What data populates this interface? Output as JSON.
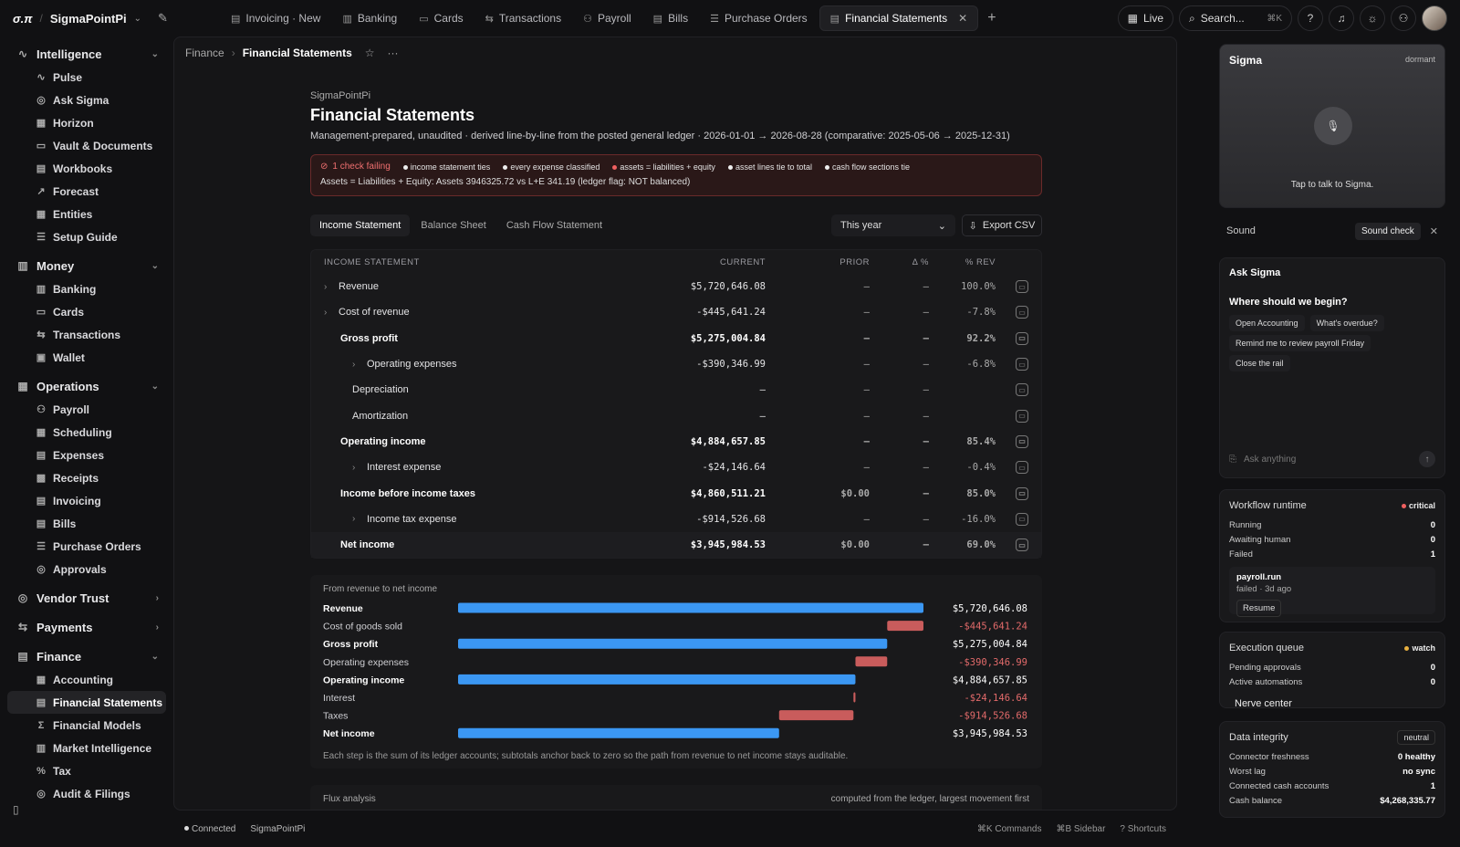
{
  "topbar": {
    "logo": "σ.π",
    "workspace": "SigmaPointPi",
    "tabs": [
      {
        "label": "Invoicing · New",
        "icon": "▤"
      },
      {
        "label": "Banking",
        "icon": "▥"
      },
      {
        "label": "Cards",
        "icon": "▭"
      },
      {
        "label": "Transactions",
        "icon": "⇆"
      },
      {
        "label": "Payroll",
        "icon": "⚇"
      },
      {
        "label": "Bills",
        "icon": "▤"
      },
      {
        "label": "Purchase Orders",
        "icon": "☰"
      },
      {
        "label": "Financial Statements",
        "icon": "▤",
        "active": true
      }
    ],
    "live_label": "Live",
    "search_placeholder": "Search...",
    "search_shortcut": "⌘K"
  },
  "sidebar": {
    "groups": [
      {
        "label": "Intelligence",
        "icon": "∿",
        "expanded": true,
        "items": [
          {
            "label": "Pulse",
            "icon": "∿"
          },
          {
            "label": "Ask Sigma",
            "icon": "◎"
          },
          {
            "label": "Horizon",
            "icon": "▦"
          },
          {
            "label": "Vault & Documents",
            "icon": "▭"
          },
          {
            "label": "Workbooks",
            "icon": "▤"
          },
          {
            "label": "Forecast",
            "icon": "↗"
          },
          {
            "label": "Entities",
            "icon": "▦"
          },
          {
            "label": "Setup Guide",
            "icon": "☰"
          }
        ]
      },
      {
        "label": "Money",
        "icon": "▥",
        "expanded": true,
        "items": [
          {
            "label": "Banking",
            "icon": "▥"
          },
          {
            "label": "Cards",
            "icon": "▭"
          },
          {
            "label": "Transactions",
            "icon": "⇆"
          },
          {
            "label": "Wallet",
            "icon": "▣"
          }
        ]
      },
      {
        "label": "Operations",
        "icon": "▦",
        "expanded": true,
        "items": [
          {
            "label": "Payroll",
            "icon": "⚇"
          },
          {
            "label": "Scheduling",
            "icon": "▦"
          },
          {
            "label": "Expenses",
            "icon": "▤"
          },
          {
            "label": "Receipts",
            "icon": "▩"
          },
          {
            "label": "Invoicing",
            "icon": "▤"
          },
          {
            "label": "Bills",
            "icon": "▤"
          },
          {
            "label": "Purchase Orders",
            "icon": "☰"
          },
          {
            "label": "Approvals",
            "icon": "◎"
          }
        ]
      },
      {
        "label": "Vendor Trust",
        "icon": "◎",
        "expanded": false,
        "items": []
      },
      {
        "label": "Payments",
        "icon": "⇆",
        "expanded": false,
        "items": []
      },
      {
        "label": "Finance",
        "icon": "▤",
        "expanded": true,
        "items": [
          {
            "label": "Accounting",
            "icon": "▦"
          },
          {
            "label": "Financial Statements",
            "icon": "▤",
            "active": true
          },
          {
            "label": "Financial Models",
            "icon": "Σ"
          },
          {
            "label": "Market Intelligence",
            "icon": "▥"
          },
          {
            "label": "Tax",
            "icon": "%"
          },
          {
            "label": "Audit & Filings",
            "icon": "◎"
          }
        ]
      }
    ]
  },
  "breadcrumb": {
    "parent": "Finance",
    "current": "Financial Statements"
  },
  "page": {
    "org": "SigmaPointPi",
    "title": "Financial Statements",
    "subtitle": "Management-prepared, unaudited · derived line-by-line from the posted general ledger · 2026-01-01 → 2026-08-28 (comparative: 2025-05-06 → 2025-12-31)"
  },
  "checks": {
    "failing": "1 check failing",
    "items": [
      {
        "label": "income statement ties",
        "ok": true
      },
      {
        "label": "every expense classified",
        "ok": true
      },
      {
        "label": "assets = liabilities + equity",
        "ok": false
      },
      {
        "label": "asset lines tie to total",
        "ok": true
      },
      {
        "label": "cash flow sections tie",
        "ok": true
      }
    ],
    "detail": "Assets = Liabilities + Equity: Assets 3946325.72 vs L+E 341.19 (ledger flag: NOT balanced)"
  },
  "statement_tabs": [
    "Income Statement",
    "Balance Sheet",
    "Cash Flow Statement"
  ],
  "period": "This year",
  "export_label": "Export CSV",
  "table": {
    "headers": [
      "INCOME STATEMENT",
      "CURRENT",
      "PRIOR",
      "Δ %",
      "% REV"
    ],
    "rows": [
      {
        "label": "Revenue",
        "current": "$5,720,646.08",
        "prior": "—",
        "delta": "—",
        "rev": "100.0%",
        "level": 0,
        "expandable": true,
        "bold": false
      },
      {
        "label": "Cost of revenue",
        "current": "-$445,641.24",
        "prior": "—",
        "delta": "—",
        "rev": "-7.8%",
        "level": 0,
        "expandable": true,
        "bold": false
      },
      {
        "label": "Gross profit",
        "current": "$5,275,004.84",
        "prior": "—",
        "delta": "—",
        "rev": "92.2%",
        "level": 1,
        "expandable": false,
        "bold": true
      },
      {
        "label": "Operating expenses",
        "current": "-$390,346.99",
        "prior": "—",
        "delta": "—",
        "rev": "-6.8%",
        "level": 2,
        "expandable": true,
        "bold": false
      },
      {
        "label": "Depreciation",
        "current": "—",
        "prior": "—",
        "delta": "—",
        "rev": "",
        "level": 3,
        "expandable": false,
        "bold": false
      },
      {
        "label": "Amortization",
        "current": "—",
        "prior": "—",
        "delta": "—",
        "rev": "",
        "level": 3,
        "expandable": false,
        "bold": false
      },
      {
        "label": "Operating income",
        "current": "$4,884,657.85",
        "prior": "—",
        "delta": "—",
        "rev": "85.4%",
        "level": 1,
        "expandable": false,
        "bold": true
      },
      {
        "label": "Interest expense",
        "current": "-$24,146.64",
        "prior": "—",
        "delta": "—",
        "rev": "-0.4%",
        "level": 2,
        "expandable": true,
        "bold": false
      },
      {
        "label": "Income before income taxes",
        "current": "$4,860,511.21",
        "prior": "$0.00",
        "delta": "—",
        "rev": "85.0%",
        "level": 1,
        "expandable": false,
        "bold": true
      },
      {
        "label": "Income tax expense",
        "current": "-$914,526.68",
        "prior": "—",
        "delta": "—",
        "rev": "-16.0%",
        "level": 2,
        "expandable": true,
        "bold": false
      },
      {
        "label": "Net income",
        "current": "$3,945,984.53",
        "prior": "$0.00",
        "delta": "—",
        "rev": "69.0%",
        "level": 1,
        "expandable": false,
        "bold": true
      }
    ]
  },
  "chart_data": {
    "type": "bar",
    "title": "From revenue to net income",
    "categories": [
      "Revenue",
      "Cost of goods sold",
      "Gross profit",
      "Operating expenses",
      "Operating income",
      "Interest",
      "Taxes",
      "Net income"
    ],
    "values": [
      5720646.08,
      -445641.24,
      5275004.84,
      -390346.99,
      4884657.85,
      -24146.64,
      -914526.68,
      3945984.53
    ],
    "labels": [
      "$5,720,646.08",
      "-$445,641.24",
      "$5,275,004.84",
      "-$390,346.99",
      "$4,884,657.85",
      "-$24,146.64",
      "-$914,526.68",
      "$3,945,984.53"
    ],
    "subtotal": [
      true,
      false,
      true,
      false,
      true,
      false,
      false,
      true
    ],
    "note": "Each step is the sum of its ledger accounts; subtotals anchor back to zero so the path from revenue to net income stays auditable.",
    "colors": {
      "positive": "#3b97f3",
      "negative": "#c95c5c"
    }
  },
  "flux": {
    "title": "Flux analysis",
    "note": "computed from the ledger, largest movement first"
  },
  "statusbar": {
    "connected": "Connected",
    "workspace": "SigmaPointPi",
    "commands": "⌘K Commands",
    "sidebar": "⌘B Sidebar",
    "shortcuts": "? Shortcuts"
  },
  "rail": {
    "sigma": {
      "name": "Sigma",
      "state": "dormant",
      "tap": "Tap to talk to Sigma."
    },
    "sound": {
      "label": "Sound",
      "check": "Sound check"
    },
    "ask": {
      "title": "Ask Sigma",
      "question": "Where should we begin?",
      "chips": [
        "Open Accounting",
        "What's overdue?",
        "Remind me to review payroll Friday",
        "Close the rail"
      ],
      "placeholder": "Ask anything"
    },
    "workflow": {
      "title": "Workflow runtime",
      "badge": "critical",
      "rows": [
        {
          "k": "Running",
          "v": "0"
        },
        {
          "k": "Awaiting human",
          "v": "0"
        },
        {
          "k": "Failed",
          "v": "1"
        }
      ],
      "job": {
        "name": "payroll.run",
        "status": "failed · 3d ago",
        "action": "Resume"
      }
    },
    "queue": {
      "title": "Execution queue",
      "badge": "watch",
      "rows": [
        {
          "k": "Pending approvals",
          "v": "0"
        },
        {
          "k": "Active automations",
          "v": "0"
        }
      ],
      "link": "Nerve center"
    },
    "integrity": {
      "title": "Data integrity",
      "badge": "neutral",
      "rows": [
        {
          "k": "Connector freshness",
          "v": "0 healthy"
        },
        {
          "k": "Worst lag",
          "v": "no sync"
        },
        {
          "k": "Connected cash accounts",
          "v": "1"
        },
        {
          "k": "Cash balance",
          "v": "$4,268,335.77"
        }
      ]
    }
  },
  "colors": {
    "critical": "#f06060",
    "watch": "#e8b040",
    "accent": "#3b97f3"
  }
}
